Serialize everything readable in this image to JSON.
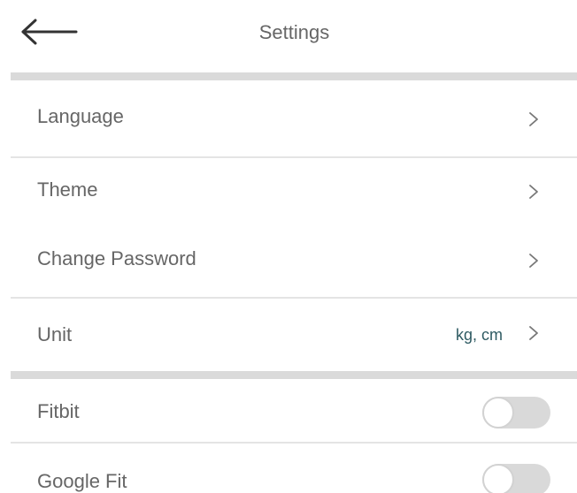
{
  "header": {
    "title": "Settings",
    "back_icon": "arrow-left-icon"
  },
  "rows": {
    "language": {
      "label": "Language"
    },
    "theme": {
      "label": "Theme"
    },
    "change_password": {
      "label": "Change Password"
    },
    "unit": {
      "label": "Unit",
      "value": "kg, cm"
    },
    "fitbit": {
      "label": "Fitbit",
      "enabled": false
    },
    "google_fit": {
      "label": "Google Fit",
      "enabled": false
    }
  },
  "icons": {
    "row_arrow": "chevron-right-icon"
  },
  "colors": {
    "divider": "#dadada",
    "unit_value": "#2f5b63",
    "toggle_off": "#d9d9d9"
  }
}
